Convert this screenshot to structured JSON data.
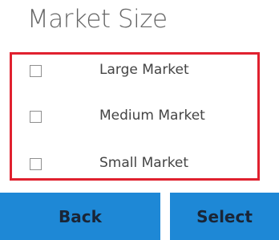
{
  "title": "Market Size",
  "options": [
    {
      "label": "Large Market",
      "checked": false
    },
    {
      "label": "Medium Market",
      "checked": false
    },
    {
      "label": "Small Market",
      "checked": false
    }
  ],
  "buttons": {
    "back_label": "Back",
    "select_label": "Select"
  },
  "colors": {
    "highlight_border": "#e0212f",
    "button_bg": "#1e88d6",
    "button_text": "#1a2536"
  }
}
